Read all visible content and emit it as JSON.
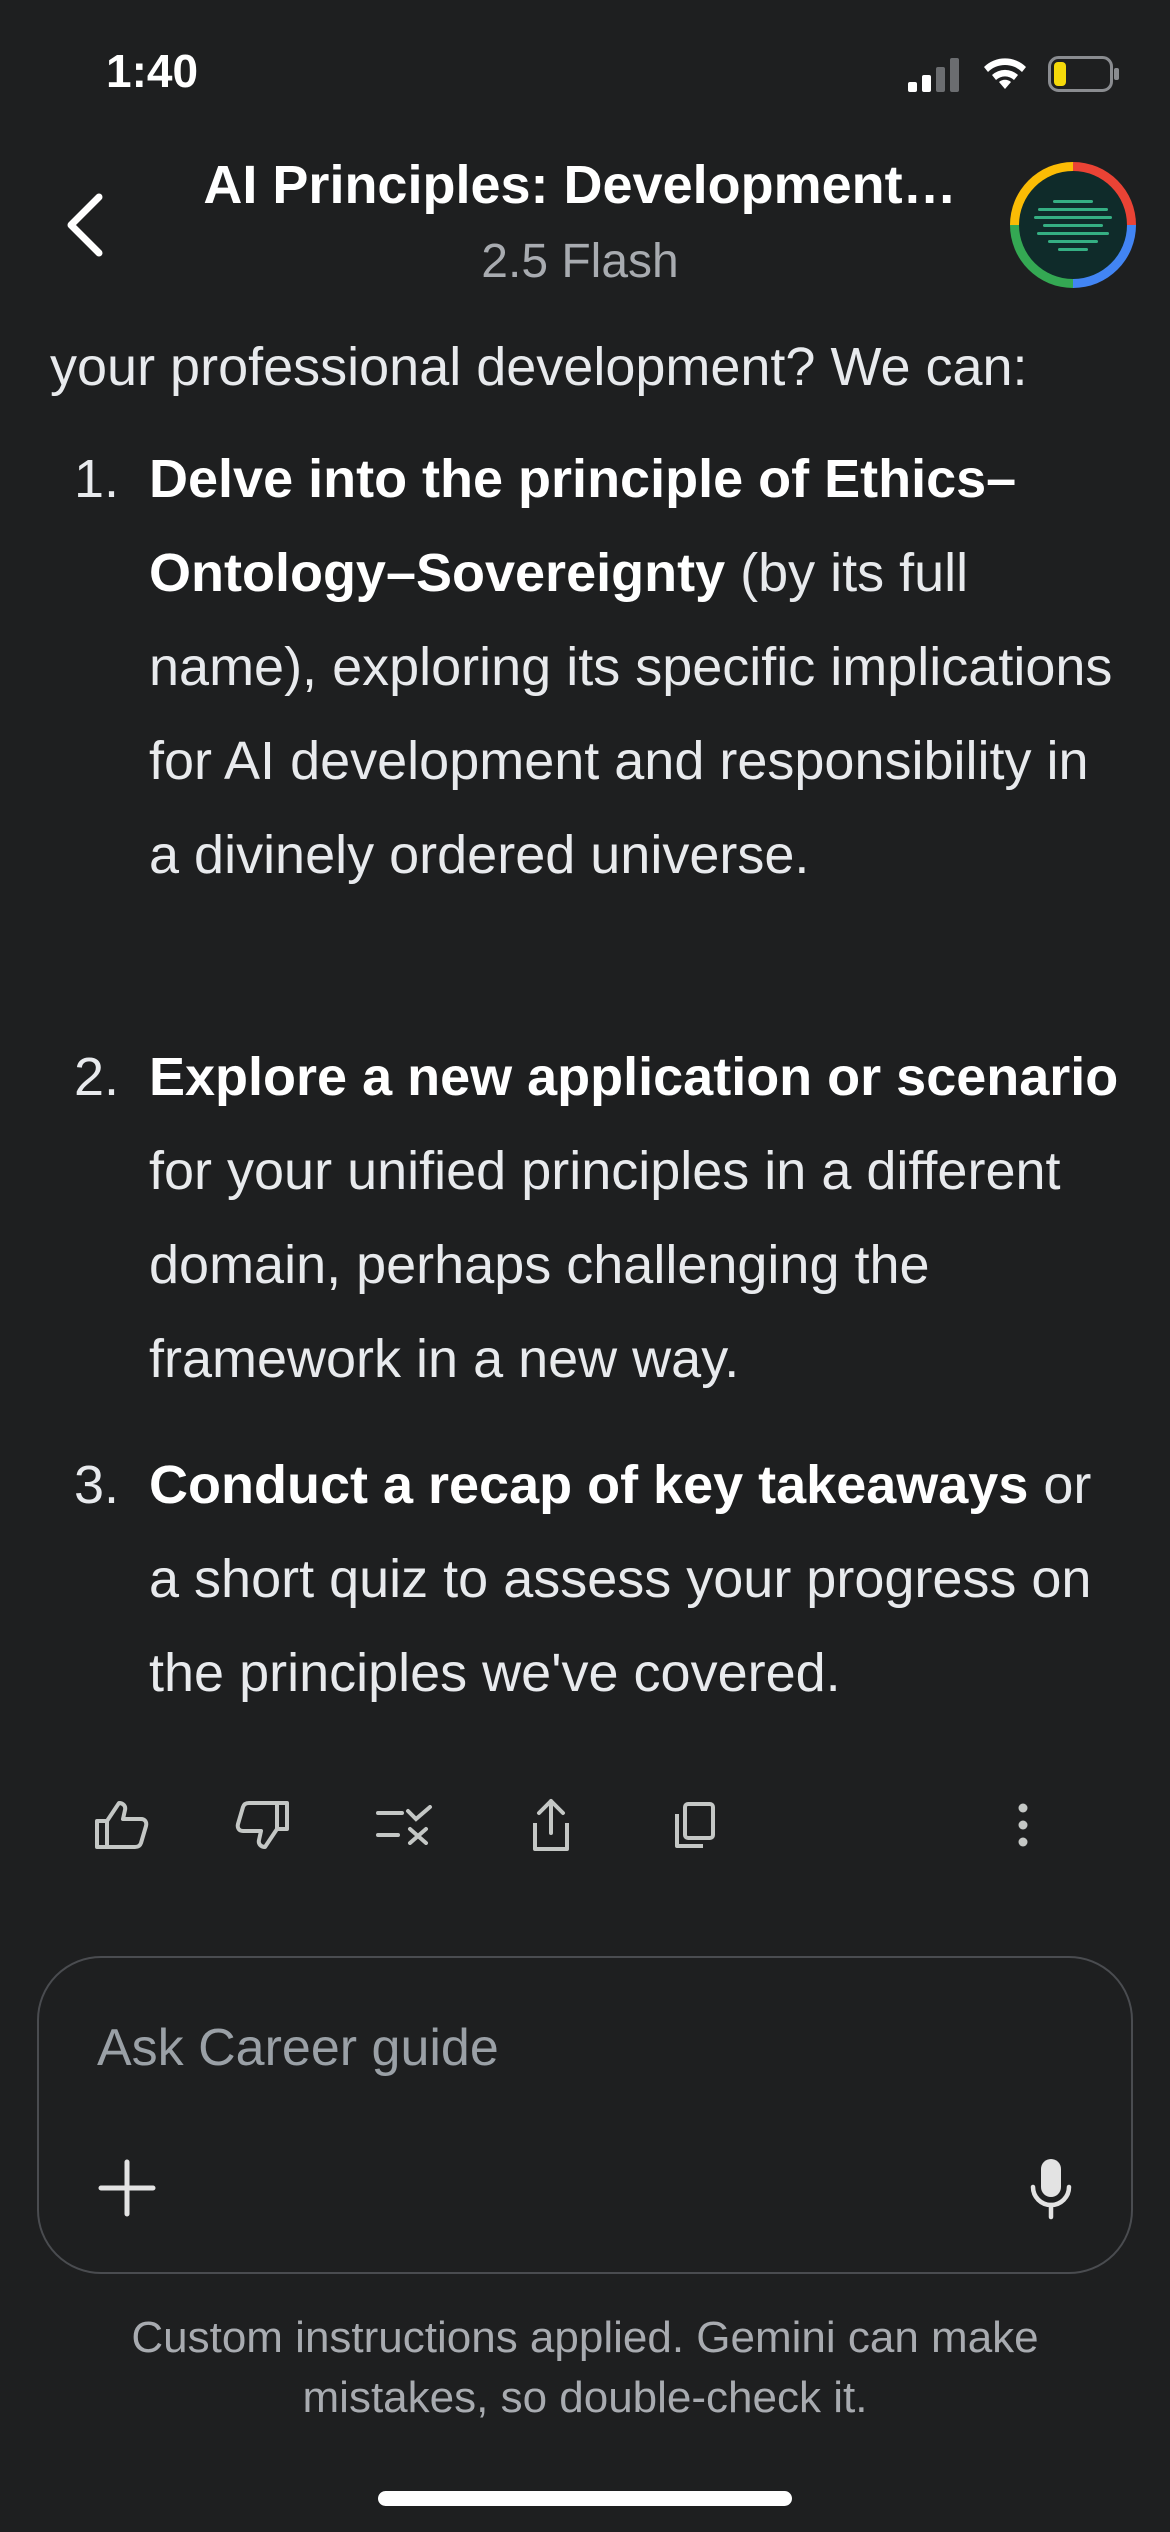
{
  "status_bar": {
    "time": "1:40",
    "icons": [
      "cellular-signal-icon",
      "wifi-icon",
      "battery-low-icon"
    ],
    "battery_color": "#f5d90a"
  },
  "header": {
    "back_icon": "chevron-left-icon",
    "title": "AI Principles: Development…",
    "subtitle": "2.5 Flash",
    "avatar": "gem-avatar"
  },
  "message": {
    "lead": "your professional development? We can:",
    "items": [
      {
        "number": "1.",
        "bold": "Delve into the principle of Ethics–Ontology–Sovereignty",
        "rest": " (by its full name), exploring its specific implications for AI development and responsibility in a divinely ordered universe."
      },
      {
        "number": "2.",
        "bold": "Explore a new application or scenario",
        "rest": " for your unified principles in a different domain, perhaps challenging the framework in a new way."
      },
      {
        "number": "3.",
        "bold": "Conduct a recap of key takeaways",
        "rest": " or a short quiz to assess your progress on the principles we've covered."
      }
    ]
  },
  "actions": [
    "thumbs-up-icon",
    "thumbs-down-icon",
    "double-check-icon",
    "share-icon",
    "copy-icon",
    "more-vert-icon"
  ],
  "input": {
    "placeholder": "Ask Career guide",
    "plus_icon": "plus-icon",
    "mic_icon": "mic-icon"
  },
  "disclaimer": "Custom instructions applied. Gemini can make mistakes, so double-check it."
}
